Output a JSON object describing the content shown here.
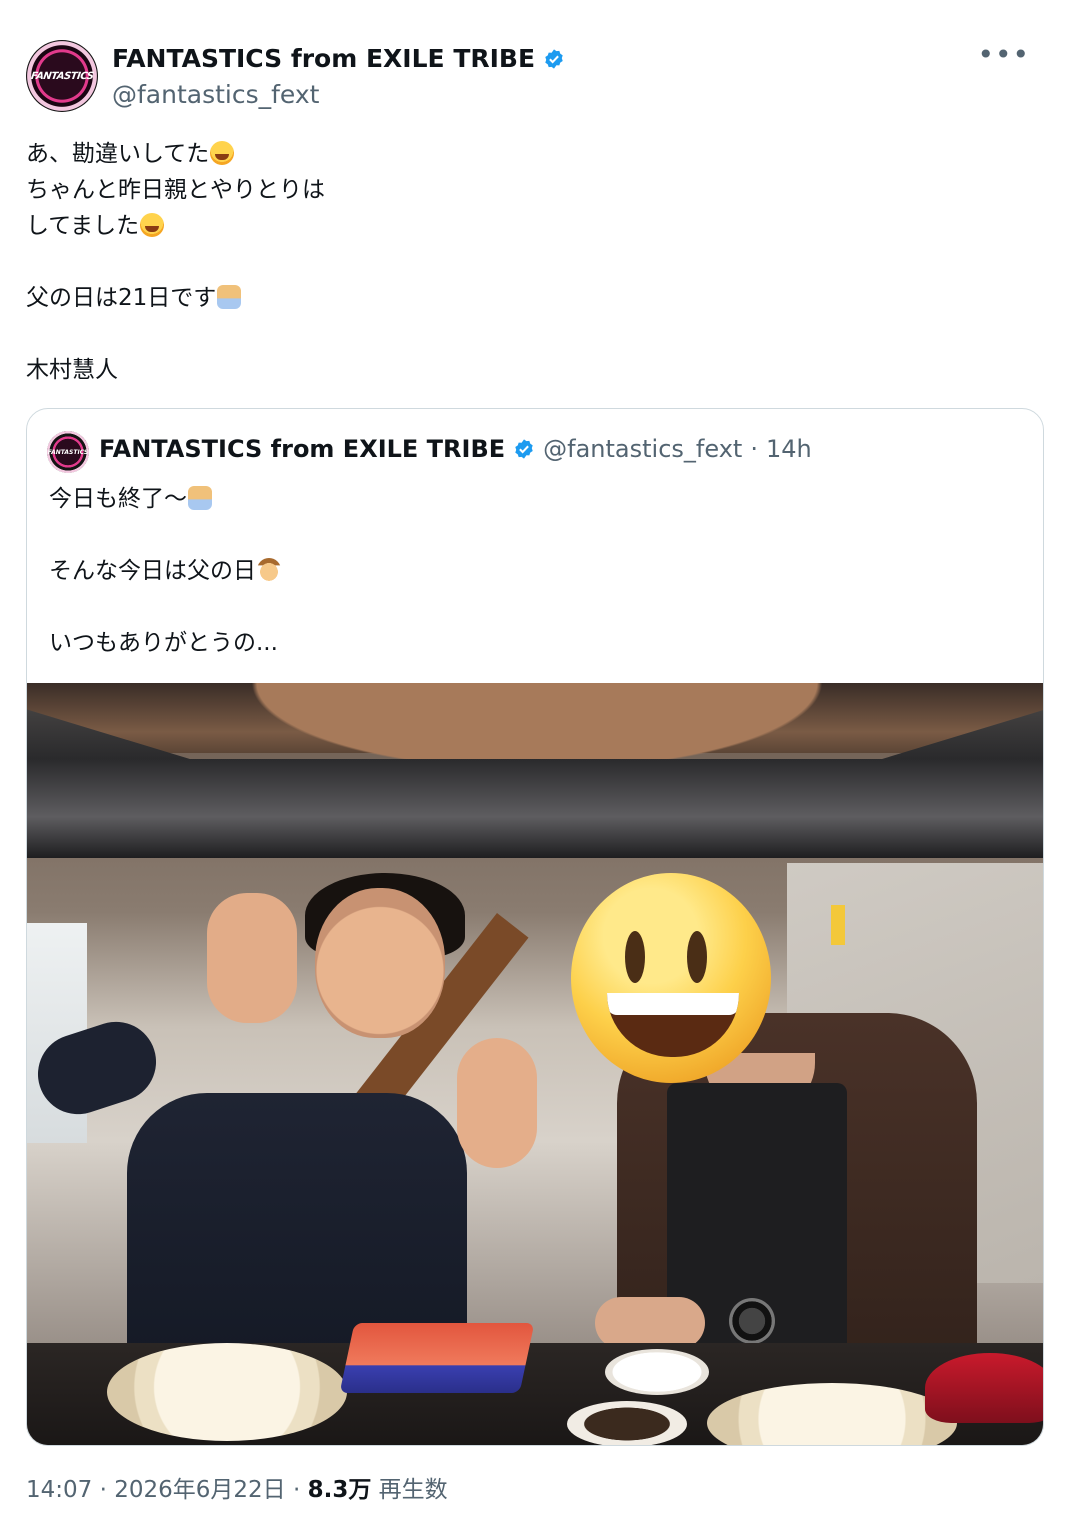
{
  "author": {
    "name": "FANTASTICS from EXILE TRIBE",
    "handle": "@fantastics_fext",
    "avatar_logo_text": "FANTASTICS",
    "verified_color": "#1d9bf0"
  },
  "more_icon": "more-horizontal-icon",
  "tweet": {
    "line1": "あ、勘違いしてた",
    "line2": "ちゃんと昨日親とやりとりは",
    "line3": "してました",
    "line4": "父の日は21日です",
    "line5": "木村慧人"
  },
  "quote": {
    "name": "FANTASTICS from EXILE TRIBE",
    "handle": "@fantastics_fext",
    "separator": "·",
    "time": "14h",
    "line1": "今日も終了〜",
    "line2": "そんな今日は父の日",
    "line3": "いつもありがとうの..."
  },
  "meta": {
    "time": "14:07",
    "date": "2026年6月22日",
    "views": "8.3万",
    "views_label": "再生数",
    "sep": "·"
  }
}
